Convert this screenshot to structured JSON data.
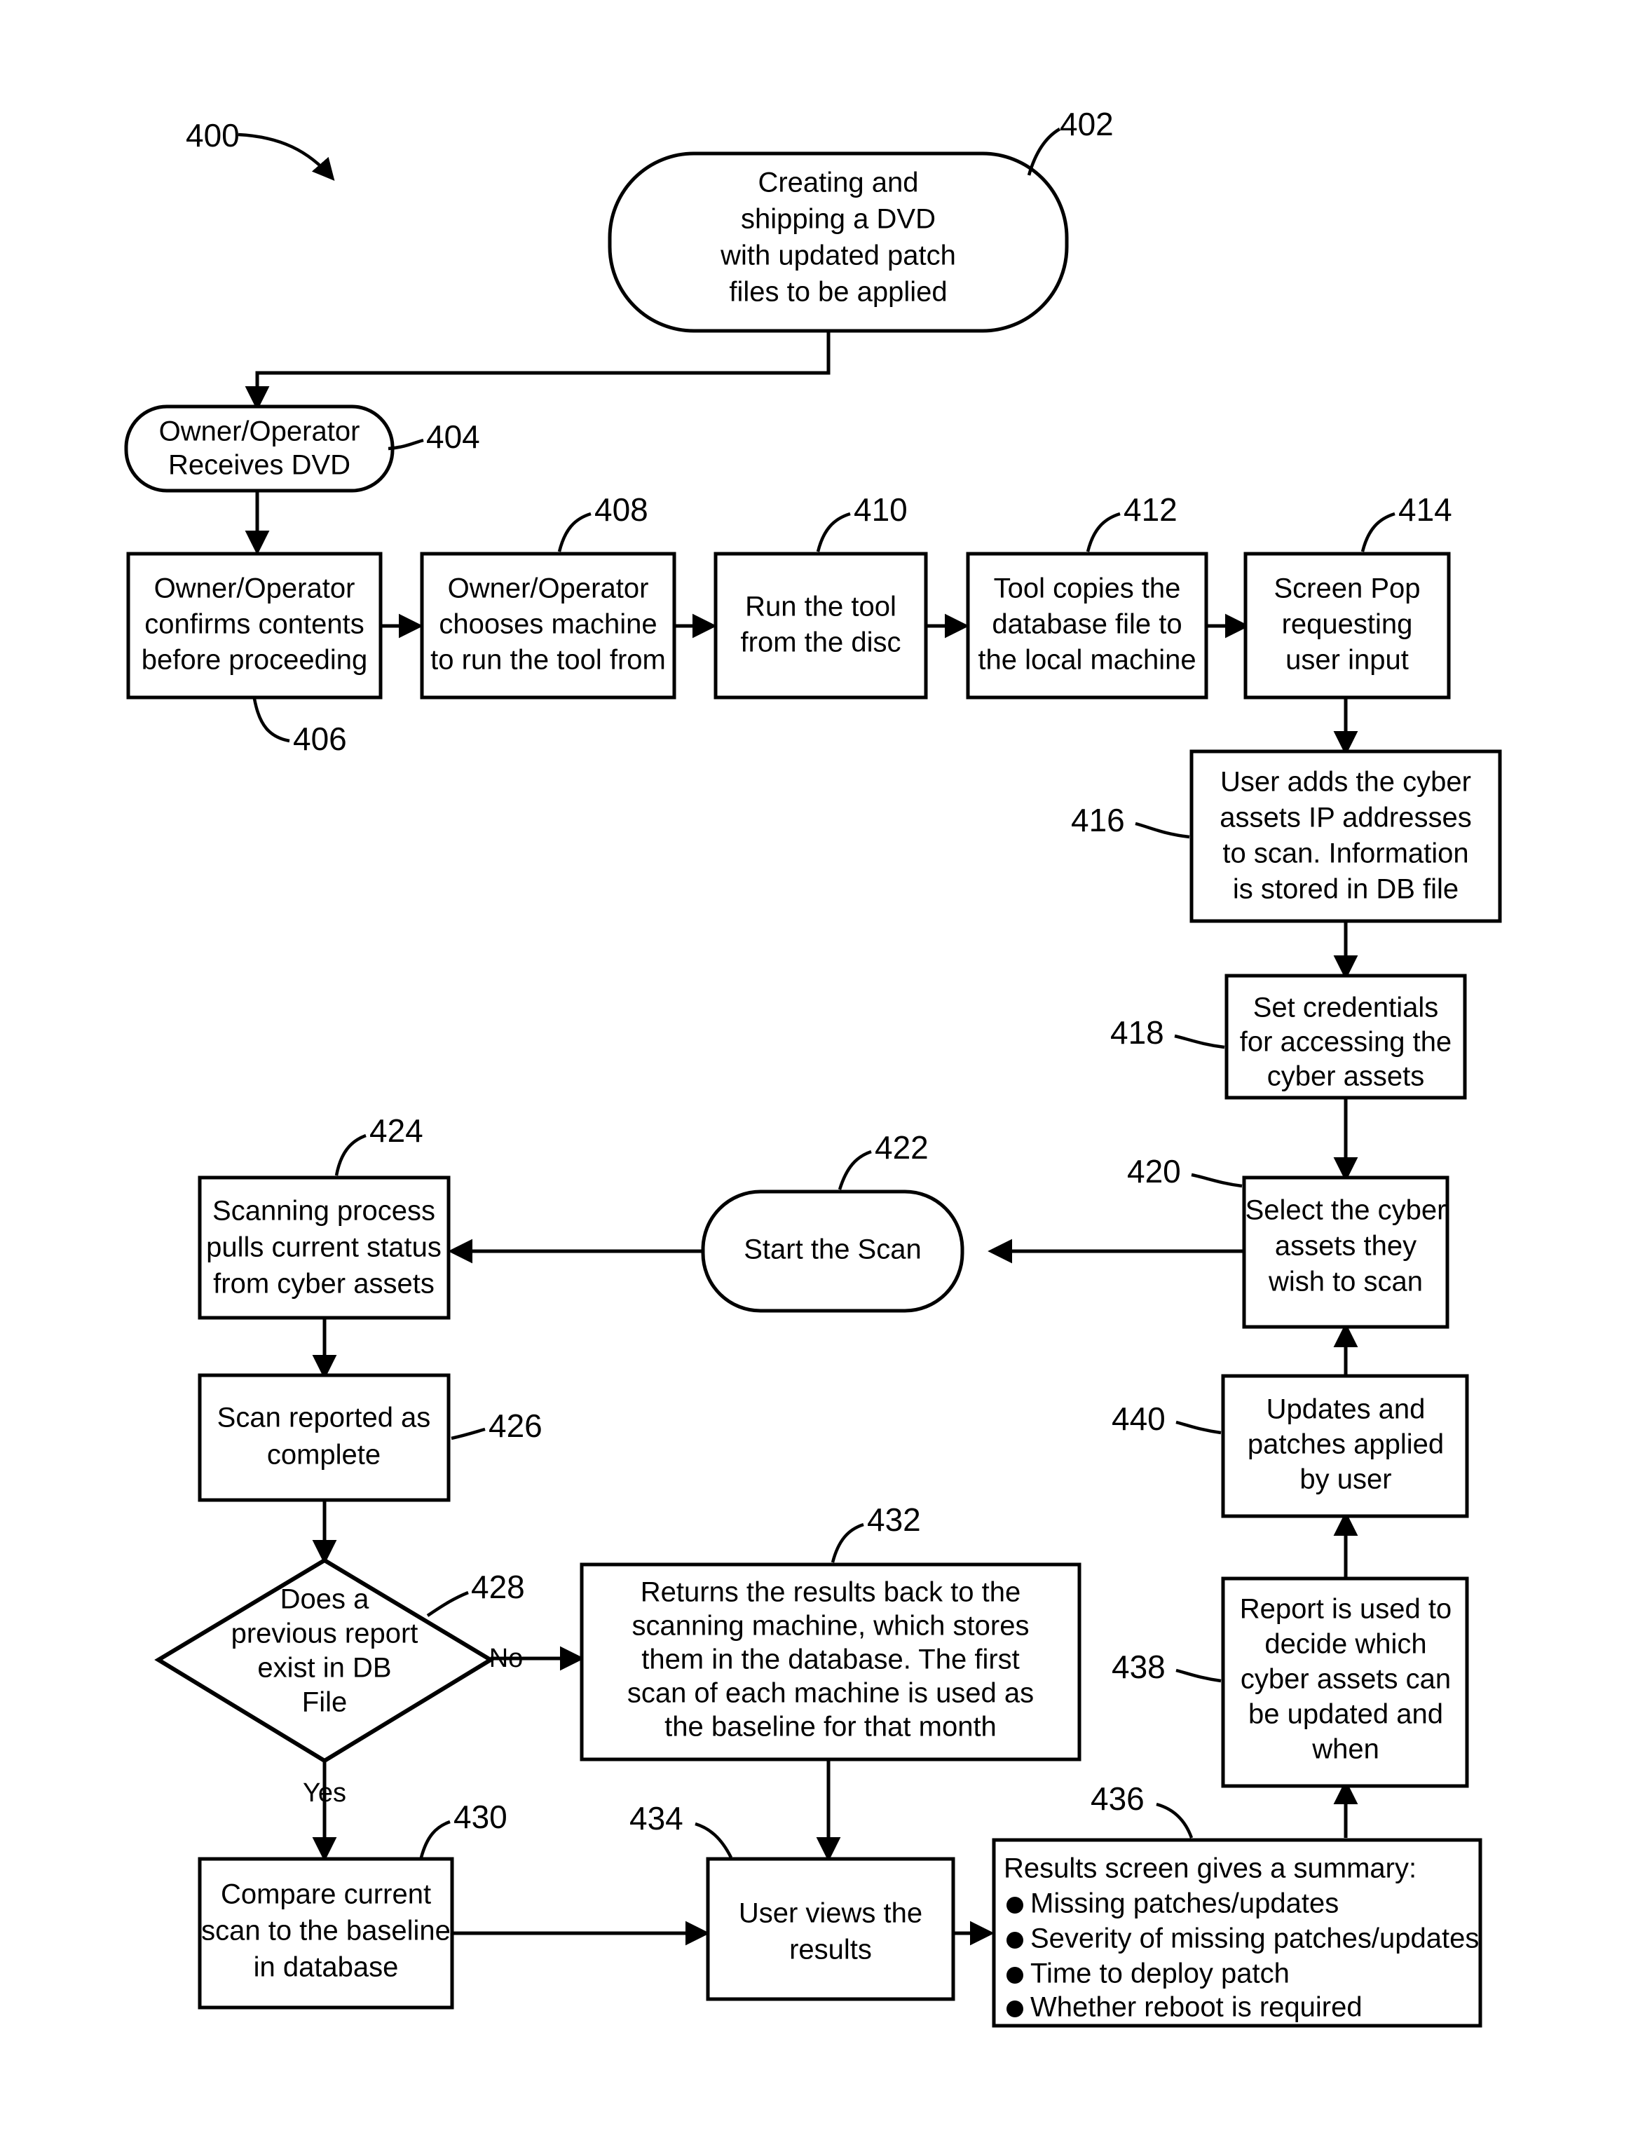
{
  "figure": {
    "figure_ref": "400",
    "background_color": "#ffffff",
    "line_color": "#000000"
  },
  "nodes": {
    "n402": {
      "ref": "402",
      "shape": "rounded-terminal",
      "lines": [
        "Creating and",
        "shipping a DVD",
        "with updated patch",
        "files to be applied"
      ]
    },
    "n404": {
      "ref": "404",
      "shape": "rounded-terminal",
      "lines": [
        "Owner/Operator",
        "Receives DVD"
      ]
    },
    "n406": {
      "ref": "406",
      "shape": "process",
      "lines": [
        "Owner/Operator",
        "confirms contents",
        "before proceeding"
      ]
    },
    "n408": {
      "ref": "408",
      "shape": "process",
      "lines": [
        "Owner/Operator",
        "chooses machine",
        "to run the tool from"
      ]
    },
    "n410": {
      "ref": "410",
      "shape": "process",
      "lines": [
        "Run the tool",
        "from the disc"
      ]
    },
    "n412": {
      "ref": "412",
      "shape": "process",
      "lines": [
        "Tool copies the",
        "database file to",
        "the local machine"
      ]
    },
    "n414": {
      "ref": "414",
      "shape": "process",
      "lines": [
        "Screen Pop",
        "requesting",
        "user input"
      ]
    },
    "n416": {
      "ref": "416",
      "shape": "process",
      "lines": [
        "User adds the cyber",
        "assets IP addresses",
        "to scan. Information",
        "is stored in DB file"
      ]
    },
    "n418": {
      "ref": "418",
      "shape": "process",
      "lines": [
        "Set credentials",
        "for accessing the",
        "cyber assets"
      ]
    },
    "n420": {
      "ref": "420",
      "shape": "process",
      "lines": [
        "Select the cyber",
        "assets they",
        "wish to scan"
      ]
    },
    "n422": {
      "ref": "422",
      "shape": "rounded-terminal",
      "lines": [
        "Start the Scan"
      ]
    },
    "n424": {
      "ref": "424",
      "shape": "process",
      "lines": [
        "Scanning process",
        "pulls current status",
        "from cyber assets"
      ]
    },
    "n426": {
      "ref": "426",
      "shape": "process",
      "lines": [
        "Scan reported as",
        "complete"
      ]
    },
    "n428": {
      "ref": "428",
      "shape": "decision",
      "lines": [
        "Does a",
        "previous report",
        "exist in DB",
        "File"
      ]
    },
    "n430": {
      "ref": "430",
      "shape": "process",
      "lines": [
        "Compare current",
        "scan to the baseline",
        "in database"
      ]
    },
    "n432": {
      "ref": "432",
      "shape": "process",
      "lines": [
        "Returns the results back to the",
        "scanning machine, which stores",
        "them in the database. The first",
        "scan of each machine is used as",
        "the baseline for that month"
      ]
    },
    "n434": {
      "ref": "434",
      "shape": "process",
      "lines": [
        "User views the",
        "results"
      ]
    },
    "n436": {
      "ref": "436",
      "shape": "process",
      "heading": "Results screen gives a summary:",
      "bullets": [
        "Missing patches/updates",
        "Severity of missing patches/updates",
        "Time to deploy patch",
        "Whether reboot is required"
      ]
    },
    "n438": {
      "ref": "438",
      "shape": "process",
      "lines": [
        "Report is used to",
        "decide which",
        "cyber assets can",
        "be updated and",
        "when"
      ]
    },
    "n440": {
      "ref": "440",
      "shape": "process",
      "lines": [
        "Updates and",
        "patches applied",
        "by user"
      ]
    }
  },
  "edge_labels": {
    "decision_no": "No",
    "decision_yes": "Yes"
  }
}
